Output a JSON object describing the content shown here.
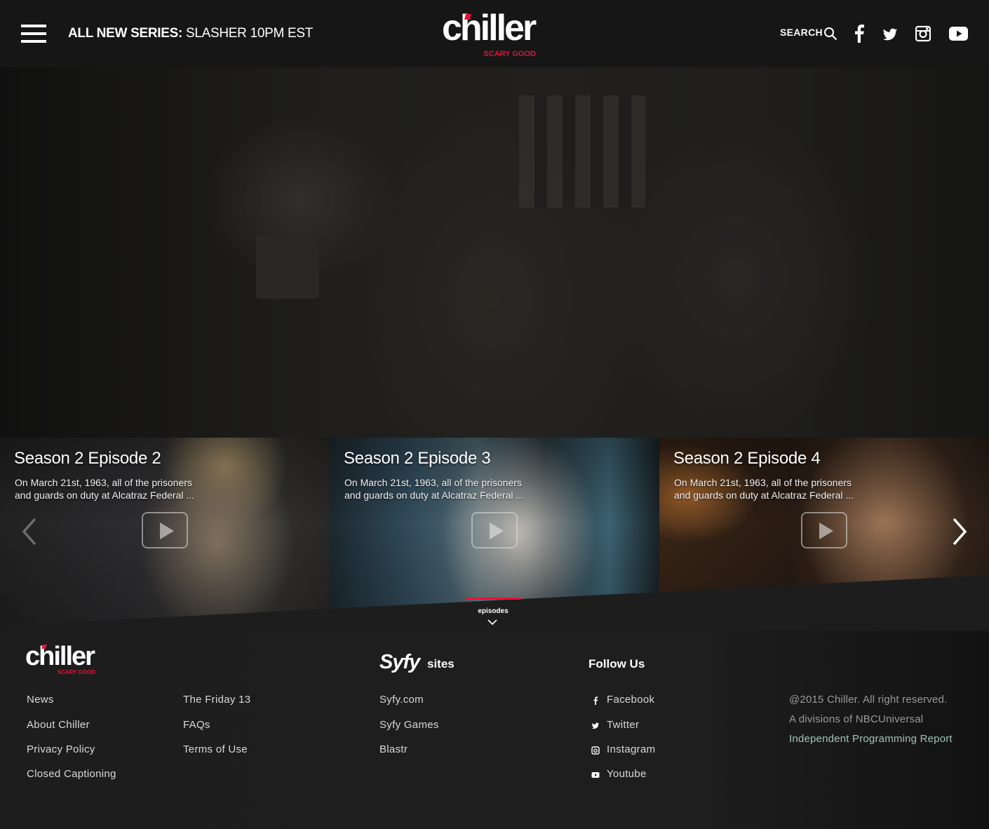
{
  "header": {
    "promo_strong": "ALL NEW SERIES:",
    "promo_rest": "SLASHER 10PM EST",
    "logo_word": "chiller",
    "logo_tag": "SCARY GOOD",
    "search_label": "SEARCH"
  },
  "episodes": {
    "items": [
      {
        "title": "Season 2 Episode 2",
        "desc_line1": "On March 21st, 1963, all of the prisoners",
        "desc_line2": "and guards on duty at Alcatraz Federal ..."
      },
      {
        "title": "Season 2 Episode 3",
        "desc_line1": "On March 21st, 1963, all of the prisoners",
        "desc_line2": "and guards on duty at Alcatraz Federal ..."
      },
      {
        "title": "Season 2 Episode 4",
        "desc_line1": "On March 21st, 1963, all of the prisoners",
        "desc_line2": "and guards on duty at Alcatraz Federal ..."
      }
    ],
    "tab_label": "episodes"
  },
  "footer": {
    "logo_word": "chiller",
    "logo_tag": "SCARY GOOD",
    "col1": [
      "News",
      "About Chiller",
      "Privacy Policy",
      "Closed Captioning"
    ],
    "col2": [
      "The Friday 13",
      "FAQs",
      "Terms of Use"
    ],
    "syfy_logo": "Syfy",
    "syfy_sites_label": "sites",
    "syfy_links": [
      "Syfy.com",
      "Syfy Games",
      "Blastr"
    ],
    "follow_heading": "Follow Us",
    "follow_links": [
      "Facebook",
      "Twitter",
      "Instagram",
      "Youtube"
    ],
    "copyright": "@2015 Chiller. All right reserved.",
    "division": "A divisions of NBCUniversal",
    "report_link": "Independent Programming Report"
  },
  "colors": {
    "accent": "#e4123a",
    "header_bg": "#161616",
    "footer_bg": "#1d1d1d",
    "report_link": "#9fc4ba"
  }
}
